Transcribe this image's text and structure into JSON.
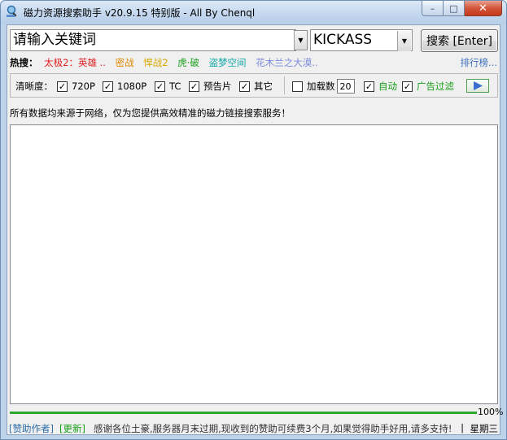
{
  "window": {
    "title": "磁力资源搜索助手 v20.9.15 特别版 - All By Chenql",
    "minimize_glyph": "–",
    "maximize_glyph": "□",
    "close_glyph": "✕"
  },
  "search": {
    "placeholder": "请输入关键词",
    "engine": "KICKASS",
    "button_label": "搜索 [Enter]"
  },
  "hot": {
    "label": "热搜：",
    "items": [
      {
        "text": "太极2：英雄 ..",
        "color": "#e02020"
      },
      {
        "text": "密战",
        "color": "#e08a00"
      },
      {
        "text": "悍战2",
        "color": "#d6a900"
      },
      {
        "text": "虎·破",
        "color": "#19a019"
      },
      {
        "text": "盗梦空间",
        "color": "#13a7a7"
      },
      {
        "text": "花木兰之大漠..",
        "color": "#7a8ad8"
      }
    ],
    "rank_link": "排行榜..."
  },
  "options": {
    "clarity_label": "清晰度：",
    "items": [
      {
        "label": "720P",
        "checked": true
      },
      {
        "label": "1080P",
        "checked": true
      },
      {
        "label": "TC",
        "checked": true
      },
      {
        "label": "预告片",
        "checked": true
      },
      {
        "label": "其它",
        "checked": true
      }
    ],
    "load_count_label": "加载数",
    "load_count_checked": false,
    "load_count_value": "20",
    "auto_label": "自动",
    "auto_checked": true,
    "ad_filter_label": "广告过滤",
    "ad_filter_checked": true
  },
  "notice": "所有数据均来源于网络，仅为您提供高效精准的磁力链接搜索服务！",
  "progress": {
    "value": 1.0,
    "label": "100%"
  },
  "status": {
    "sponsor": "[赞助作者]",
    "update": "[更新]",
    "thanks": "感谢各位土豪,服务器月末过期,现收到的赞助可续费3个月,如果觉得助手好用,请多支持!",
    "separator": "|",
    "weekday": "星期三"
  },
  "colors": {
    "accent_green": "#19a019",
    "link_blue": "#3f6fbf"
  }
}
